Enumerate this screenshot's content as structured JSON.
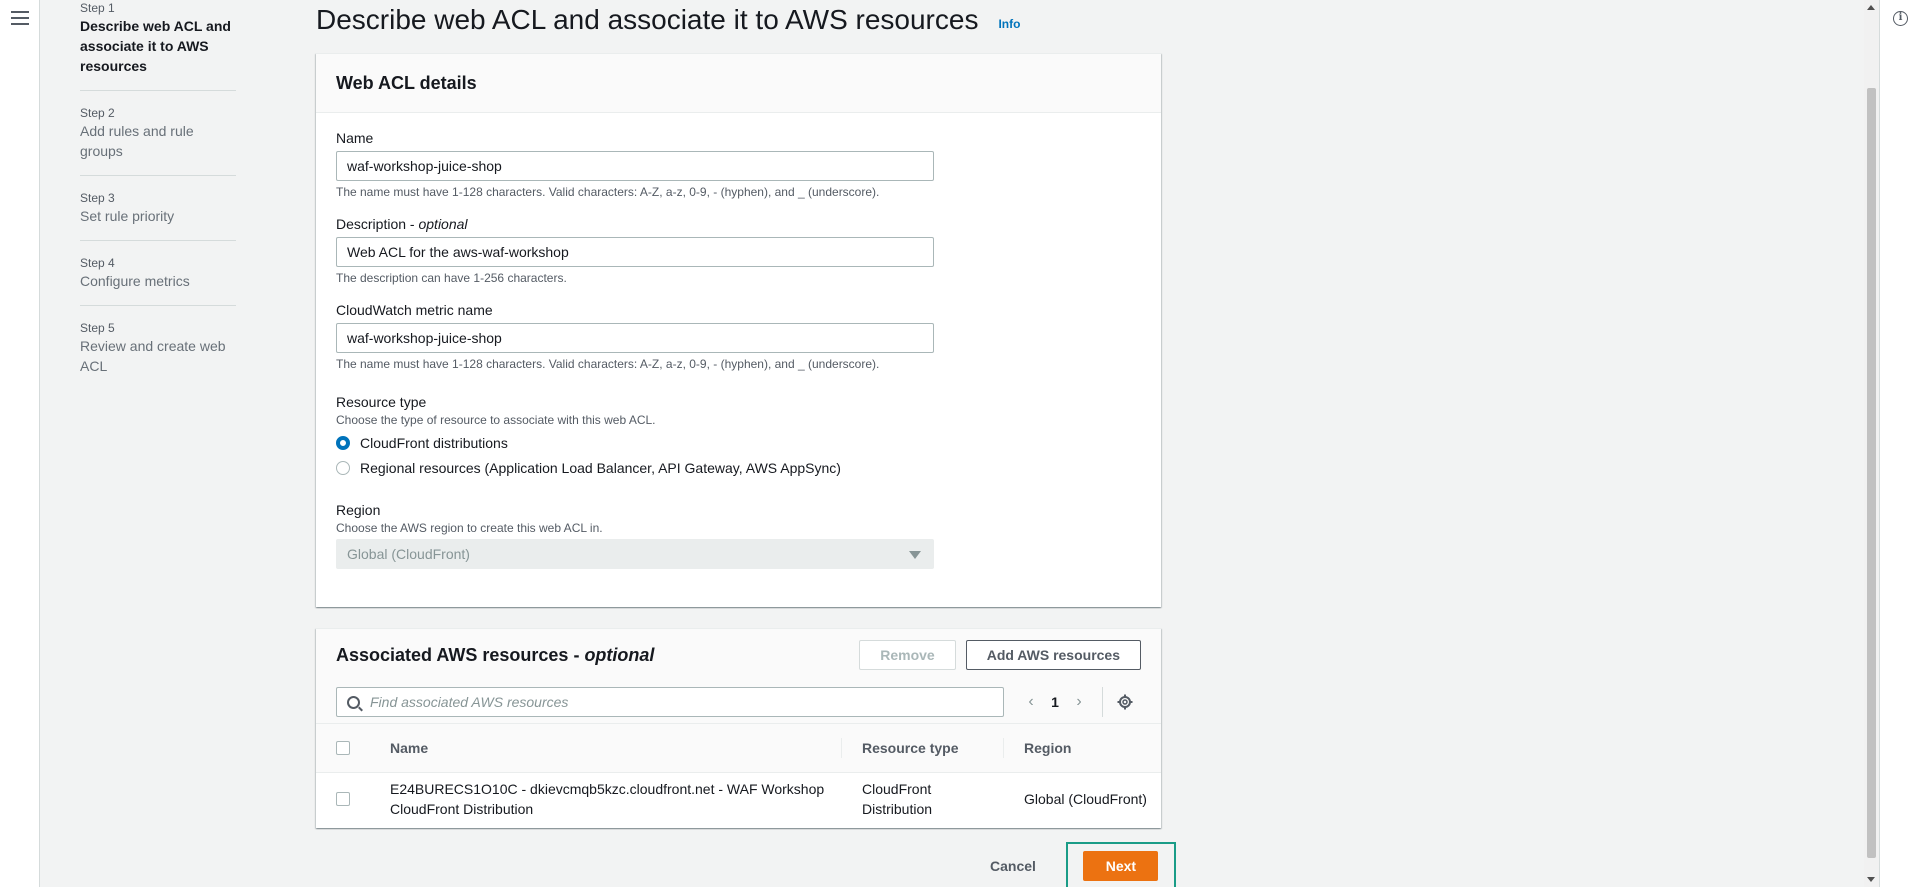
{
  "steps": [
    {
      "num": "Step 1",
      "title": "Describe web ACL and associate it to AWS resources"
    },
    {
      "num": "Step 2",
      "title": "Add rules and rule groups"
    },
    {
      "num": "Step 3",
      "title": "Set rule priority"
    },
    {
      "num": "Step 4",
      "title": "Configure metrics"
    },
    {
      "num": "Step 5",
      "title": "Review and create web ACL"
    }
  ],
  "page": {
    "title": "Describe web ACL and associate it to AWS resources",
    "info": "Info"
  },
  "details": {
    "heading": "Web ACL details",
    "name_label": "Name",
    "name_value": "waf-workshop-juice-shop",
    "name_hint": "The name must have 1-128 characters. Valid characters: A-Z, a-z, 0-9, - (hyphen), and _ (underscore).",
    "desc_label": "Description",
    "desc_optional": "optional",
    "desc_sep": " - ",
    "desc_value": "Web ACL for the aws-waf-workshop",
    "desc_hint": "The description can have 1-256 characters.",
    "metric_label": "CloudWatch metric name",
    "metric_value": "waf-workshop-juice-shop",
    "metric_hint": "The name must have 1-128 characters. Valid characters: A-Z, a-z, 0-9, - (hyphen), and _ (underscore).",
    "resource_type_label": "Resource type",
    "resource_type_hint": "Choose the type of resource to associate with this web ACL.",
    "resource_options": [
      {
        "label": "CloudFront distributions",
        "selected": true
      },
      {
        "label": "Regional resources (Application Load Balancer, API Gateway, AWS AppSync)",
        "selected": false
      }
    ],
    "region_label": "Region",
    "region_hint": "Choose the AWS region to create this web ACL in.",
    "region_value": "Global (CloudFront)"
  },
  "resources": {
    "heading": "Associated AWS resources",
    "heading_optional": "optional",
    "heading_sep": " - ",
    "remove_label": "Remove",
    "add_label": "Add AWS resources",
    "search_placeholder": "Find associated AWS resources",
    "page_number": "1",
    "columns": [
      "Name",
      "Resource type",
      "Region"
    ],
    "rows": [
      {
        "name": "E24BURECS1O10C - dkievcmqb5kzc.cloudfront.net - WAF Workshop CloudFront Distribution",
        "type": "CloudFront Distribution",
        "region": "Global (CloudFront)"
      }
    ]
  },
  "footer": {
    "cancel_label": "Cancel",
    "next_label": "Next"
  },
  "colors": {
    "primary_button": "#ec7211",
    "link": "#0073bb",
    "highlight": "#1a9c87"
  }
}
